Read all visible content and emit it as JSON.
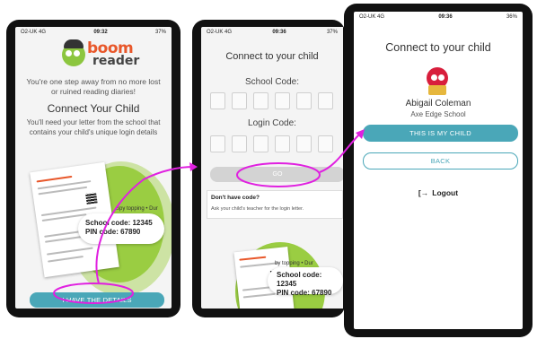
{
  "phone1": {
    "status": {
      "carrier": "O2-UK 4G",
      "time": "09:32",
      "battery": "37%"
    },
    "logo": {
      "word1": "boom",
      "word2": "reader"
    },
    "tagline": "You're one step away from no more lost or ruined reading diaries!",
    "title": "Connect Your Child",
    "subtitle": "You'll need your letter from the school that contains your child's unique login details",
    "letter_caption": "Spy topping • Dur",
    "school_code": "School code: 12345",
    "pin_code": "PIN code: 67890",
    "button": "I HAVE THE DETAILS"
  },
  "phone2": {
    "status": {
      "carrier": "O2-UK 4G",
      "time": "09:36",
      "battery": "37%"
    },
    "title": "Connect to your child",
    "school_code_label": "School Code:",
    "login_code_label": "Login Code:",
    "school_digits": [
      "",
      "",
      "",
      "",
      "",
      ""
    ],
    "login_digits": [
      "",
      "",
      "",
      "",
      "",
      ""
    ],
    "go_button": "GO",
    "no_code_heading": "Don't have code?",
    "no_code_text": "Ask your child's teacher for the login letter.",
    "letter_caption": "by topping • Dur",
    "school_code": "School code: 12345",
    "pin_code": "PIN code: 67890"
  },
  "phone3": {
    "status": {
      "carrier": "O2-UK 4G",
      "time": "09:36",
      "battery": "36%"
    },
    "title": "Connect to your child",
    "child_name": "Abigail Coleman",
    "school_name": "Axe Edge School",
    "confirm_button": "THIS IS MY CHILD",
    "back_button": "BACK",
    "logout_icon": "[→",
    "logout_label": "Logout"
  },
  "colors": {
    "teal": "#4aa7b8",
    "highlight": "#e020e0",
    "green": "#9acd42",
    "brand_orange": "#e8572a"
  }
}
